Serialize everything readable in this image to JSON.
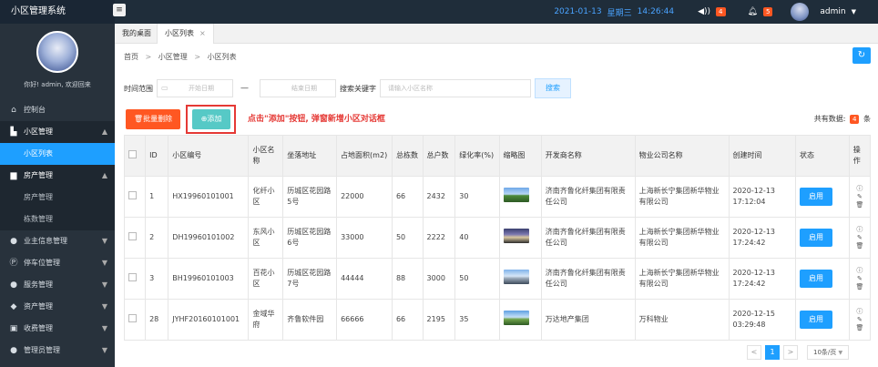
{
  "app": {
    "title": "小区管理系统"
  },
  "topbar": {
    "date": "2021-01-13",
    "weekday": "星期三",
    "time": "14:26:44",
    "message_badge": "4",
    "notice_badge": "5",
    "user": "admin"
  },
  "sidebar": {
    "welcome": "你好! admin, 欢迎回来",
    "items": [
      {
        "label": "控制台",
        "icon": "home-icon"
      },
      {
        "label": "小区管理",
        "icon": "building-icon"
      },
      {
        "label": "小区列表"
      },
      {
        "label": "房产管理",
        "icon": "house-icon"
      },
      {
        "label": "房产管理"
      },
      {
        "label": "栋数管理"
      },
      {
        "label": "业主信息管理",
        "icon": "user-icon"
      },
      {
        "label": "停车位管理",
        "icon": "parking-icon"
      },
      {
        "label": "服务管理",
        "icon": "service-icon"
      },
      {
        "label": "资产管理",
        "icon": "asset-icon"
      },
      {
        "label": "收费管理",
        "icon": "fee-icon"
      },
      {
        "label": "管理员管理",
        "icon": "admin-icon"
      }
    ]
  },
  "tabs": [
    {
      "label": "我的桌面"
    },
    {
      "label": "小区列表"
    }
  ],
  "breadcrumb": {
    "home": "首页",
    "mid": "小区管理",
    "current": "小区列表",
    "sep": ">"
  },
  "filter": {
    "time_label": "时间范围",
    "start_placeholder": "开始日期",
    "end_placeholder": "结束日期",
    "dash": "—",
    "kw_label": "搜索关键字",
    "kw_placeholder": "请输入小区名称",
    "search_label": "搜索"
  },
  "actions": {
    "batch_delete": "批量删除",
    "add": "添加",
    "hint": "点击\"添加\"按钮, 弹窗新增小区对话框",
    "total_label": "共有数据:",
    "total_count": "4",
    "total_unit": "条"
  },
  "table": {
    "headers": [
      "ID",
      "小区编号",
      "小区名称",
      "坐落地址",
      "占地面积(m2)",
      "总栋数",
      "总户数",
      "绿化率(%)",
      "缩略图",
      "开发商名称",
      "物业公司名称",
      "创建时间",
      "状态",
      "操作"
    ],
    "rows": [
      {
        "id": "1",
        "code": "HX19960101001",
        "name": "化纤小区",
        "address": "历城区花园路5号",
        "area": "22000",
        "buildings": "66",
        "households": "2432",
        "green": "30",
        "developer": "济南齐鲁化纤集团有限责任公司",
        "property": "上海新长宁集团新华物业有限公司",
        "created": "2020-12-13 17:12:04",
        "status": "启用"
      },
      {
        "id": "2",
        "code": "DH19960101002",
        "name": "东风小区",
        "address": "历城区花园路6号",
        "area": "33000",
        "buildings": "50",
        "households": "2222",
        "green": "40",
        "developer": "济南齐鲁化纤集团有限责任公司",
        "property": "上海新长宁集团新华物业有限公司",
        "created": "2020-12-13 17:24:42",
        "status": "启用"
      },
      {
        "id": "3",
        "code": "BH19960101003",
        "name": "百花小区",
        "address": "历城区花园路7号",
        "area": "44444",
        "buildings": "88",
        "households": "3000",
        "green": "50",
        "developer": "济南齐鲁化纤集团有限责任公司",
        "property": "上海新长宁集团新华物业有限公司",
        "created": "2020-12-13 17:24:42",
        "status": "启用"
      },
      {
        "id": "28",
        "code": "JYHF20160101001",
        "name": "金域华府",
        "address": "齐鲁软件园",
        "area": "66666",
        "buildings": "66",
        "households": "2195",
        "green": "35",
        "developer": "万达地产集团",
        "property": "万科物业",
        "created": "2020-12-15 03:29:48",
        "status": "启用"
      }
    ]
  },
  "pager": {
    "prev": "<",
    "page": "1",
    "next": ">",
    "page_size": "10条/页"
  },
  "colors": {
    "accent": "#1e9fff",
    "danger": "#ff5722",
    "teal": "#56c9c6",
    "sidebar": "#28323c"
  }
}
